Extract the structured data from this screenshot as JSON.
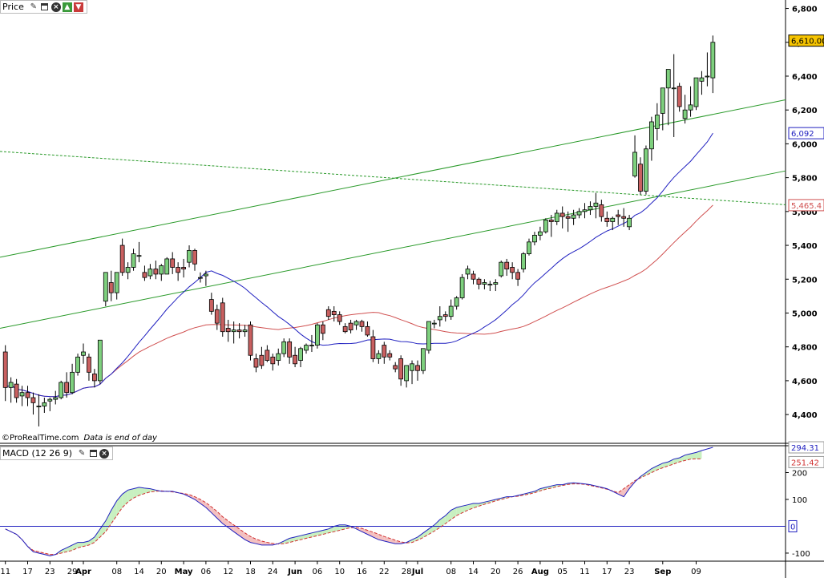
{
  "price_panel": {
    "title": "Price",
    "last_price_label": "6,610.00",
    "ma20_label": "6,092",
    "ma50_label": "5,465.4",
    "copyright": "©ProRealTime.com",
    "data_note": "Data is end of day"
  },
  "macd_panel": {
    "title": "MACD (12 26 9)",
    "macd_label": "294.31",
    "signal_label": "251.42",
    "zero_label": "0"
  },
  "icons": [
    "wrench-icon",
    "window-icon",
    "close-icon",
    "arrow-up-icon",
    "arrow-down-icon"
  ],
  "colors": {
    "up": "#7ed07e",
    "down": "#c96060",
    "ma20": "#2020c0",
    "ma50": "#d05050",
    "trend": "#2a9a2a",
    "macd": "#2020c0",
    "signal": "#d03030",
    "macd_fill_pos": "#c8f0c0",
    "macd_fill_neg": "#f4c0c0",
    "last_price_bg": "#f6c400"
  },
  "chart_data": [
    {
      "type": "candlestick",
      "title": "Price",
      "y_ticks": [
        "6,800",
        "6,600",
        "6,400",
        "6,200",
        "6,000",
        "5,800",
        "5,600",
        "5,400",
        "5,200",
        "5,000",
        "4,800",
        "4,600",
        "4,400"
      ],
      "ylim": [
        4230,
        6850
      ],
      "x_ticks": [
        {
          "i": 0,
          "label": "11",
          "bold": false
        },
        {
          "i": 4,
          "label": "17",
          "bold": false
        },
        {
          "i": 8,
          "label": "23",
          "bold": false
        },
        {
          "i": 12,
          "label": "29",
          "bold": false
        },
        {
          "i": 14,
          "label": "Apr",
          "bold": true
        },
        {
          "i": 20,
          "label": "08",
          "bold": false
        },
        {
          "i": 24,
          "label": "14",
          "bold": false
        },
        {
          "i": 28,
          "label": "20",
          "bold": false
        },
        {
          "i": 32,
          "label": "May",
          "bold": true
        },
        {
          "i": 36,
          "label": "06",
          "bold": false
        },
        {
          "i": 40,
          "label": "12",
          "bold": false
        },
        {
          "i": 44,
          "label": "18",
          "bold": false
        },
        {
          "i": 48,
          "label": "24",
          "bold": false
        },
        {
          "i": 52,
          "label": "Jun",
          "bold": true
        },
        {
          "i": 56,
          "label": "06",
          "bold": false
        },
        {
          "i": 60,
          "label": "10",
          "bold": false
        },
        {
          "i": 64,
          "label": "16",
          "bold": false
        },
        {
          "i": 68,
          "label": "22",
          "bold": false
        },
        {
          "i": 72,
          "label": "28",
          "bold": false
        },
        {
          "i": 74,
          "label": "Jul",
          "bold": true
        },
        {
          "i": 80,
          "label": "08",
          "bold": false
        },
        {
          "i": 84,
          "label": "14",
          "bold": false
        },
        {
          "i": 88,
          "label": "20",
          "bold": false
        },
        {
          "i": 92,
          "label": "26",
          "bold": false
        },
        {
          "i": 96,
          "label": "Aug",
          "bold": true
        },
        {
          "i": 100,
          "label": "05",
          "bold": false
        },
        {
          "i": 104,
          "label": "11",
          "bold": false
        },
        {
          "i": 108,
          "label": "17",
          "bold": false
        },
        {
          "i": 112,
          "label": "23",
          "bold": false
        },
        {
          "i": 118,
          "label": "Sep",
          "bold": true
        },
        {
          "i": 124,
          "label": "09",
          "bold": false
        }
      ],
      "candles": [
        [
          4770,
          4810,
          4480,
          4560
        ],
        [
          4560,
          4620,
          4470,
          4590
        ],
        [
          4580,
          4610,
          4470,
          4500
        ],
        [
          4510,
          4570,
          4450,
          4530
        ],
        [
          4530,
          4570,
          4450,
          4500
        ],
        [
          4500,
          4530,
          4400,
          4470
        ],
        [
          4450,
          4520,
          4330,
          4450
        ],
        [
          4450,
          4500,
          4410,
          4470
        ],
        [
          4480,
          4500,
          4420,
          4490
        ],
        [
          4490,
          4540,
          4460,
          4500
        ],
        [
          4500,
          4600,
          4490,
          4590
        ],
        [
          4590,
          4650,
          4500,
          4530
        ],
        [
          4530,
          4700,
          4520,
          4650
        ],
        [
          4650,
          4760,
          4630,
          4740
        ],
        [
          4750,
          4820,
          4700,
          4770
        ],
        [
          4740,
          4760,
          4600,
          4650
        ],
        [
          4640,
          4670,
          4560,
          4600
        ],
        [
          4600,
          4840,
          4580,
          4840
        ],
        [
          5070,
          5220,
          5040,
          5240
        ],
        [
          5180,
          5250,
          5070,
          5120
        ],
        [
          5120,
          5240,
          5080,
          5240
        ],
        [
          5400,
          5440,
          5220,
          5240
        ],
        [
          5240,
          5300,
          5200,
          5270
        ],
        [
          5270,
          5380,
          5250,
          5350
        ],
        [
          5340,
          5420,
          5300,
          5340
        ],
        [
          5240,
          5280,
          5190,
          5210
        ],
        [
          5220,
          5290,
          5200,
          5260
        ],
        [
          5260,
          5310,
          5200,
          5230
        ],
        [
          5230,
          5290,
          5190,
          5280
        ],
        [
          5230,
          5330,
          5230,
          5320
        ],
        [
          5320,
          5360,
          5230,
          5270
        ],
        [
          5270,
          5300,
          5190,
          5240
        ],
        [
          5270,
          5320,
          5210,
          5260
        ],
        [
          5300,
          5400,
          5270,
          5370
        ],
        [
          5370,
          5380,
          5250,
          5290
        ],
        [
          5210,
          5240,
          5180,
          5210
        ],
        [
          5220,
          5250,
          5160,
          5230
        ],
        [
          5080,
          5120,
          4990,
          5010
        ],
        [
          5020,
          5050,
          4900,
          4940
        ],
        [
          5060,
          5090,
          4860,
          4890
        ],
        [
          4910,
          4960,
          4830,
          4890
        ],
        [
          4890,
          4950,
          4820,
          4900
        ],
        [
          4900,
          4940,
          4850,
          4890
        ],
        [
          4890,
          4930,
          4860,
          4900
        ],
        [
          4930,
          4950,
          4720,
          4750
        ],
        [
          4730,
          4760,
          4650,
          4680
        ],
        [
          4750,
          4800,
          4670,
          4690
        ],
        [
          4780,
          4810,
          4710,
          4720
        ],
        [
          4740,
          4760,
          4660,
          4700
        ],
        [
          4720,
          4790,
          4690,
          4760
        ],
        [
          4760,
          4850,
          4740,
          4830
        ],
        [
          4830,
          4850,
          4700,
          4740
        ],
        [
          4750,
          4800,
          4680,
          4700
        ],
        [
          4720,
          4800,
          4680,
          4790
        ],
        [
          4780,
          4820,
          4760,
          4810
        ],
        [
          4810,
          4870,
          4770,
          4810
        ],
        [
          4810,
          4940,
          4790,
          4930
        ],
        [
          4930,
          4950,
          4840,
          4880
        ],
        [
          5020,
          5040,
          4960,
          4980
        ],
        [
          5010,
          5040,
          4950,
          4990
        ],
        [
          4990,
          5010,
          4930,
          4950
        ],
        [
          4920,
          4940,
          4880,
          4890
        ],
        [
          4940,
          4960,
          4880,
          4900
        ],
        [
          4930,
          4960,
          4900,
          4950
        ],
        [
          4950,
          4960,
          4890,
          4920
        ],
        [
          4920,
          4950,
          4860,
          4870
        ],
        [
          4860,
          4900,
          4710,
          4730
        ],
        [
          4730,
          4780,
          4700,
          4760
        ],
        [
          4810,
          4830,
          4700,
          4740
        ],
        [
          4760,
          4780,
          4720,
          4740
        ],
        [
          4690,
          4710,
          4650,
          4670
        ],
        [
          4730,
          4750,
          4570,
          4610
        ],
        [
          4600,
          4690,
          4560,
          4690
        ],
        [
          4660,
          4720,
          4580,
          4700
        ],
        [
          4690,
          4720,
          4600,
          4660
        ],
        [
          4660,
          4790,
          4640,
          4790
        ],
        [
          4780,
          4950,
          4760,
          4950
        ],
        [
          4940,
          4960,
          4910,
          4940
        ],
        [
          4960,
          5040,
          4920,
          4980
        ],
        [
          4990,
          5010,
          4950,
          4980
        ],
        [
          4980,
          5080,
          4960,
          5040
        ],
        [
          5040,
          5100,
          5020,
          5090
        ],
        [
          5090,
          5230,
          5080,
          5210
        ],
        [
          5230,
          5280,
          5200,
          5260
        ],
        [
          5230,
          5250,
          5170,
          5200
        ],
        [
          5200,
          5210,
          5140,
          5170
        ],
        [
          5170,
          5200,
          5140,
          5180
        ],
        [
          5170,
          5190,
          5130,
          5170
        ],
        [
          5170,
          5200,
          5130,
          5180
        ],
        [
          5220,
          5310,
          5210,
          5300
        ],
        [
          5300,
          5320,
          5220,
          5260
        ],
        [
          5270,
          5300,
          5200,
          5240
        ],
        [
          5240,
          5260,
          5160,
          5200
        ],
        [
          5260,
          5360,
          5240,
          5350
        ],
        [
          5350,
          5440,
          5340,
          5420
        ],
        [
          5420,
          5480,
          5400,
          5460
        ],
        [
          5460,
          5510,
          5430,
          5480
        ],
        [
          5480,
          5560,
          5470,
          5550
        ],
        [
          5550,
          5580,
          5450,
          5540
        ],
        [
          5540,
          5610,
          5520,
          5590
        ],
        [
          5590,
          5630,
          5500,
          5570
        ],
        [
          5570,
          5600,
          5480,
          5560
        ],
        [
          5560,
          5610,
          5520,
          5580
        ],
        [
          5580,
          5620,
          5560,
          5600
        ],
        [
          5600,
          5650,
          5560,
          5610
        ],
        [
          5610,
          5660,
          5580,
          5630
        ],
        [
          5630,
          5710,
          5560,
          5650
        ],
        [
          5640,
          5670,
          5540,
          5570
        ],
        [
          5560,
          5600,
          5510,
          5540
        ],
        [
          5540,
          5570,
          5490,
          5560
        ],
        [
          5580,
          5610,
          5520,
          5570
        ],
        [
          5570,
          5620,
          5510,
          5560
        ],
        [
          5510,
          5580,
          5490,
          5560
        ],
        [
          5810,
          6050,
          5800,
          5950
        ],
        [
          5880,
          5920,
          5700,
          5720
        ],
        [
          5720,
          5990,
          5700,
          5970
        ],
        [
          5970,
          6160,
          5900,
          6130
        ],
        [
          6090,
          6240,
          6020,
          6170
        ],
        [
          6180,
          6310,
          6080,
          6330
        ],
        [
          6330,
          6430,
          6110,
          6440
        ],
        [
          6330,
          6530,
          6040,
          6330
        ],
        [
          6340,
          6360,
          6190,
          6220
        ],
        [
          6150,
          6290,
          6120,
          6200
        ],
        [
          6200,
          6340,
          6160,
          6230
        ],
        [
          6220,
          6360,
          6200,
          6390
        ],
        [
          6370,
          6430,
          6290,
          6390
        ],
        [
          6400,
          6540,
          6340,
          6400
        ],
        [
          6390,
          6640,
          6300,
          6600
        ]
      ]
    },
    {
      "type": "line",
      "title": "MACD (12 26 9)",
      "y_ticks": [
        "200",
        "100",
        "-100"
      ],
      "ylim": [
        -130,
        300
      ],
      "series": [
        {
          "name": "MACD",
          "values": [
            -10,
            -20,
            -30,
            -50,
            -75,
            -95,
            -100,
            -105,
            -110,
            -105,
            -90,
            -80,
            -70,
            -60,
            -60,
            -55,
            -40,
            -10,
            20,
            60,
            95,
            120,
            135,
            140,
            145,
            142,
            140,
            135,
            130,
            130,
            130,
            125,
            120,
            110,
            100,
            85,
            70,
            50,
            30,
            10,
            -5,
            -20,
            -35,
            -50,
            -60,
            -65,
            -70,
            -70,
            -70,
            -65,
            -55,
            -45,
            -40,
            -35,
            -30,
            -25,
            -20,
            -15,
            -10,
            0,
            5,
            5,
            0,
            -10,
            -20,
            -30,
            -40,
            -50,
            -55,
            -60,
            -65,
            -65,
            -60,
            -50,
            -40,
            -25,
            -10,
            5,
            25,
            40,
            60,
            70,
            75,
            80,
            85,
            85,
            90,
            95,
            100,
            105,
            110,
            110,
            115,
            120,
            125,
            130,
            140,
            145,
            150,
            155,
            155,
            160,
            162,
            160,
            158,
            155,
            150,
            145,
            140,
            130,
            120,
            110,
            140,
            165,
            185,
            200,
            215,
            225,
            235,
            240,
            250,
            255,
            265,
            270,
            275,
            282,
            288,
            294
          ]
        },
        {
          "name": "Signal",
          "values": [
            -10,
            -20,
            -30,
            -50,
            -75,
            -90,
            -95,
            -100,
            -105,
            -105,
            -100,
            -95,
            -90,
            -80,
            -75,
            -70,
            -60,
            -40,
            -20,
            10,
            40,
            70,
            90,
            105,
            115,
            122,
            128,
            130,
            132,
            130,
            128,
            125,
            122,
            118,
            110,
            100,
            88,
            72,
            55,
            35,
            20,
            5,
            -10,
            -25,
            -38,
            -48,
            -55,
            -60,
            -64,
            -66,
            -65,
            -60,
            -55,
            -50,
            -45,
            -40,
            -35,
            -30,
            -25,
            -20,
            -15,
            -10,
            -5,
            -5,
            -8,
            -15,
            -22,
            -30,
            -38,
            -45,
            -52,
            -58,
            -62,
            -60,
            -52,
            -42,
            -30,
            -18,
            -5,
            10,
            25,
            40,
            50,
            60,
            68,
            75,
            82,
            88,
            95,
            100,
            105,
            110,
            112,
            116,
            120,
            125,
            132,
            138,
            142,
            148,
            152,
            156,
            158,
            158,
            156,
            152,
            148,
            143,
            138,
            132,
            125,
            140,
            155,
            170,
            180,
            190,
            200,
            210,
            218,
            225,
            232,
            240,
            245,
            250,
            251,
            251
          ]
        }
      ]
    }
  ]
}
